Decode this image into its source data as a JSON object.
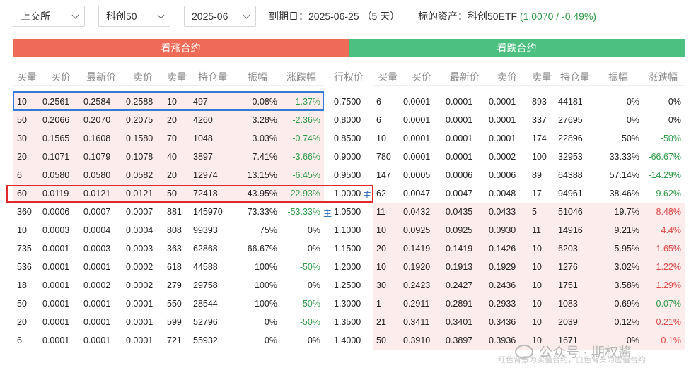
{
  "filters": {
    "exchange": "上交所",
    "underlying": "科创50",
    "month": "2025-06"
  },
  "info": {
    "expiry_label": "到期日：",
    "expiry_date": "2025-06-25",
    "days_left": "（5 天）",
    "underlying_label": "标的资产：",
    "underlying_name": "科创50ETF",
    "underlying_quote": "(1.0070 / -0.49%)"
  },
  "sections": {
    "call": "看涨合约",
    "put": "看跌合约"
  },
  "call_headers": [
    "买量",
    "买价",
    "最新价",
    "卖价",
    "卖量",
    "持仓量",
    "振幅",
    "涨跌幅"
  ],
  "strike_header": "行权价",
  "put_headers": [
    "买量",
    "买价",
    "最新价",
    "卖价",
    "卖量",
    "持仓量",
    "振幅",
    "涨跌幅"
  ],
  "main_tag": "主",
  "rows": [
    {
      "strike": "0.7500",
      "call": [
        "10",
        "0.2561",
        "0.2584",
        "0.2588",
        "10",
        "497",
        "0.08%",
        "-1.37%"
      ],
      "put": [
        "6",
        "0.0001",
        "0.0001",
        "0.0001",
        "893",
        "44181",
        "0%",
        "0%"
      ]
    },
    {
      "strike": "0.8000",
      "call": [
        "50",
        "0.2066",
        "0.2070",
        "0.2075",
        "20",
        "4260",
        "3.28%",
        "-2.36%"
      ],
      "put": [
        "6",
        "0.0001",
        "0.0001",
        "0.0001",
        "337",
        "27695",
        "0%",
        "0%"
      ]
    },
    {
      "strike": "0.8500",
      "call": [
        "30",
        "0.1565",
        "0.1608",
        "0.1580",
        "70",
        "1048",
        "3.03%",
        "-0.74%"
      ],
      "put": [
        "10",
        "0.0001",
        "0.0001",
        "0.0001",
        "174",
        "22896",
        "50%",
        "-50%"
      ]
    },
    {
      "strike": "0.9000",
      "call": [
        "20",
        "0.1071",
        "0.1079",
        "0.1078",
        "40",
        "3897",
        "7.41%",
        "-3.66%"
      ],
      "put": [
        "780",
        "0.0001",
        "0.0001",
        "0.0002",
        "100",
        "32953",
        "33.33%",
        "-66.67%"
      ]
    },
    {
      "strike": "0.9500",
      "call": [
        "6",
        "0.0580",
        "0.0580",
        "0.0582",
        "20",
        "12974",
        "13.15%",
        "-6.45%"
      ],
      "put": [
        "147",
        "0.0005",
        "0.0006",
        "0.0006",
        "89",
        "64388",
        "57.14%",
        "-14.29%"
      ]
    },
    {
      "strike": "1.0000",
      "call": [
        "60",
        "0.0119",
        "0.0121",
        "0.0121",
        "50",
        "72418",
        "43.95%",
        "-22.93%"
      ],
      "put": [
        "62",
        "0.0047",
        "0.0047",
        "0.0048",
        "17",
        "94961",
        "38.46%",
        "-9.62%"
      ]
    },
    {
      "strike": "1.0500",
      "call": [
        "360",
        "0.0006",
        "0.0007",
        "0.0007",
        "881",
        "145970",
        "73.33%",
        "-53.33%"
      ],
      "put": [
        "11",
        "0.0432",
        "0.0435",
        "0.0433",
        "5",
        "51046",
        "19.7%",
        "8.48%"
      ]
    },
    {
      "strike": "1.1000",
      "call": [
        "10",
        "0.0003",
        "0.0004",
        "0.0004",
        "808",
        "99393",
        "75%",
        "0%"
      ],
      "put": [
        "10",
        "0.0925",
        "0.0925",
        "0.0930",
        "11",
        "14916",
        "9.21%",
        "4.4%"
      ]
    },
    {
      "strike": "1.1500",
      "call": [
        "735",
        "0.0001",
        "0.0003",
        "0.0003",
        "363",
        "62868",
        "66.67%",
        "0%"
      ],
      "put": [
        "20",
        "0.1419",
        "0.1419",
        "0.1426",
        "10",
        "6203",
        "5.95%",
        "1.65%"
      ]
    },
    {
      "strike": "1.2000",
      "call": [
        "536",
        "0.0001",
        "0.0001",
        "0.0002",
        "618",
        "44588",
        "100%",
        "-50%"
      ],
      "put": [
        "10",
        "0.1920",
        "0.1913",
        "0.1929",
        "10",
        "1276",
        "3.02%",
        "1.22%"
      ]
    },
    {
      "strike": "1.2500",
      "call": [
        "18",
        "0.0001",
        "0.0002",
        "0.0002",
        "279",
        "29758",
        "100%",
        "0%"
      ],
      "put": [
        "30",
        "0.2423",
        "0.2427",
        "0.2436",
        "10",
        "1751",
        "3.58%",
        "1.29%"
      ]
    },
    {
      "strike": "1.3000",
      "call": [
        "50",
        "0.0001",
        "0.0001",
        "0.0001",
        "550",
        "28544",
        "100%",
        "-50%"
      ],
      "put": [
        "1",
        "0.2911",
        "0.2891",
        "0.2933",
        "10",
        "1083",
        "0.69%",
        "-0.07%"
      ]
    },
    {
      "strike": "1.3500",
      "call": [
        "20",
        "0.0001",
        "0.0001",
        "0.0001",
        "599",
        "52796",
        "0%",
        "-50%"
      ],
      "put": [
        "21",
        "0.3411",
        "0.3401",
        "0.3436",
        "10",
        "2039",
        "0.12%",
        "0.21%"
      ]
    },
    {
      "strike": "1.4000",
      "call": [
        "6",
        "0.0001",
        "0.0001",
        "0.0001",
        "721",
        "55932",
        "0%",
        "0%"
      ],
      "put": [
        "50",
        "0.3910",
        "0.3897",
        "0.3936",
        "10",
        "1671",
        "0%",
        "0.1%"
      ]
    }
  ],
  "watermark": "公众号 · 期权酱",
  "footnote": "红色背景为实值合约，白色背景为虚值合约",
  "colors": {
    "call_header_bg": "#ef6b57",
    "put_header_bg": "#4cc080",
    "itm_row_bg": "#fdecec",
    "up": "#e04848",
    "down": "#2e9b47",
    "highlight_blue": "#3579d4",
    "highlight_red": "#e02a2a"
  }
}
